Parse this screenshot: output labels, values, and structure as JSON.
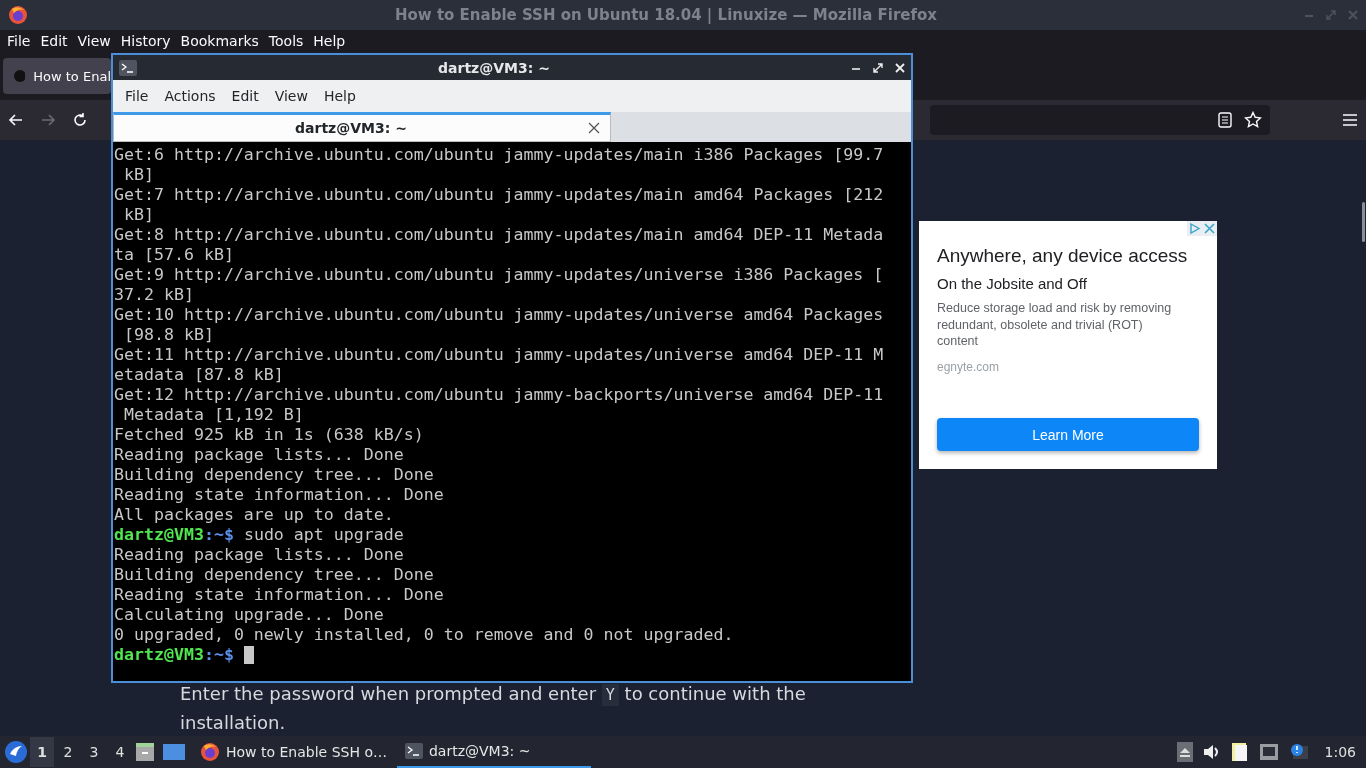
{
  "browser": {
    "title": "How to Enable SSH on Ubuntu 18.04 | Linuxize — Mozilla Firefox",
    "menu": [
      "File",
      "Edit",
      "View",
      "History",
      "Bookmarks",
      "Tools",
      "Help"
    ],
    "tab": {
      "label": "How to Enal"
    },
    "forward_disabled": true
  },
  "ad": {
    "headline": "Anywhere, any device access",
    "subhead": "On the Jobsite and Off",
    "body": "Reduce storage load and risk by removing redundant, obsolete and trivial (ROT) content",
    "domain": "egnyte.com",
    "button": "Learn More"
  },
  "article": {
    "before": "Enter the password when prompted and enter ",
    "code": "Y",
    "after": " to continue with the installation."
  },
  "terminal": {
    "title": "dartz@VM3: ~",
    "menu": [
      "File",
      "Actions",
      "Edit",
      "View",
      "Help"
    ],
    "tab": {
      "label": "dartz@VM3: ~",
      "selected": true
    },
    "lines": [
      {
        "kind": "output",
        "text": "Get:6 http://archive.ubuntu.com/ubuntu jammy-updates/main i386 Packages [99.7"
      },
      {
        "kind": "output",
        "text": " kB]"
      },
      {
        "kind": "output",
        "text": "Get:7 http://archive.ubuntu.com/ubuntu jammy-updates/main amd64 Packages [212"
      },
      {
        "kind": "output",
        "text": " kB]"
      },
      {
        "kind": "output",
        "text": "Get:8 http://archive.ubuntu.com/ubuntu jammy-updates/main amd64 DEP-11 Metada"
      },
      {
        "kind": "output",
        "text": "ta [57.6 kB]"
      },
      {
        "kind": "output",
        "text": "Get:9 http://archive.ubuntu.com/ubuntu jammy-updates/universe i386 Packages ["
      },
      {
        "kind": "output",
        "text": "37.2 kB]"
      },
      {
        "kind": "output",
        "text": "Get:10 http://archive.ubuntu.com/ubuntu jammy-updates/universe amd64 Packages"
      },
      {
        "kind": "output",
        "text": " [98.8 kB]"
      },
      {
        "kind": "output",
        "text": "Get:11 http://archive.ubuntu.com/ubuntu jammy-updates/universe amd64 DEP-11 M"
      },
      {
        "kind": "output",
        "text": "etadata [87.8 kB]"
      },
      {
        "kind": "output",
        "text": "Get:12 http://archive.ubuntu.com/ubuntu jammy-backports/universe amd64 DEP-11"
      },
      {
        "kind": "output",
        "text": " Metadata [1,192 B]"
      },
      {
        "kind": "output",
        "text": "Fetched 925 kB in 1s (638 kB/s)"
      },
      {
        "kind": "output",
        "text": "Reading package lists... Done"
      },
      {
        "kind": "output",
        "text": "Building dependency tree... Done"
      },
      {
        "kind": "output",
        "text": "Reading state information... Done"
      },
      {
        "kind": "output",
        "text": "All packages are up to date."
      },
      {
        "kind": "prompt",
        "user": "dartz@VM3",
        "path": ":~$",
        "command": " sudo apt upgrade"
      },
      {
        "kind": "output",
        "text": "Reading package lists... Done"
      },
      {
        "kind": "output",
        "text": "Building dependency tree... Done"
      },
      {
        "kind": "output",
        "text": "Reading state information... Done"
      },
      {
        "kind": "output",
        "text": "Calculating upgrade... Done"
      },
      {
        "kind": "output",
        "text": "0 upgraded, 0 newly installed, 0 to remove and 0 not upgraded."
      },
      {
        "kind": "prompt",
        "user": "dartz@VM3",
        "path": ":~$",
        "cursor": true
      }
    ]
  },
  "taskbar": {
    "workspaces": [
      {
        "label": "1",
        "selected": true
      },
      {
        "label": "2",
        "selected": false
      },
      {
        "label": "3",
        "selected": false
      },
      {
        "label": "4",
        "selected": false
      }
    ],
    "tasks": [
      {
        "kind": "firefox",
        "label": "How to Enable SSH o…",
        "selected": false
      },
      {
        "kind": "terminal",
        "label": "dartz@VM3: ~",
        "selected": true
      }
    ],
    "clock": "1:06"
  }
}
